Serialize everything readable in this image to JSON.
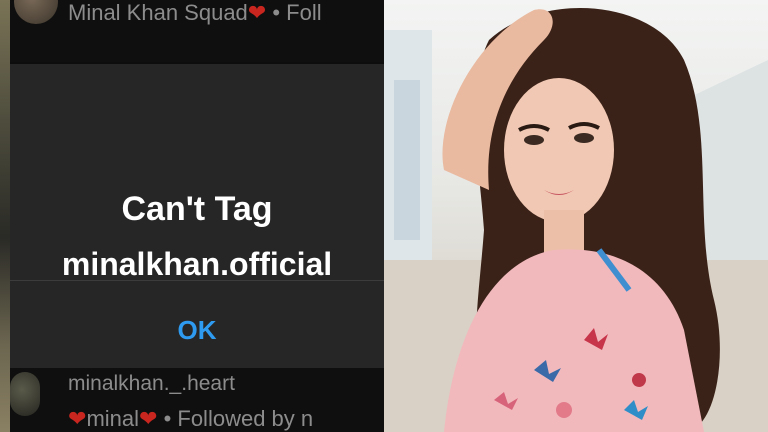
{
  "list": {
    "top_row": {
      "name": "Minal Khan Squad",
      "heart": "❤",
      "followed_prefix": " • Foll"
    },
    "bottom_row": {
      "handle": "minalkhan._.heart",
      "sub_heart1": "❤",
      "sub_name": "minal",
      "sub_heart2": "❤",
      "sub_followed": " • Followed by n"
    }
  },
  "dialog": {
    "title": "Can't Tag",
    "username": "minalkhan.official",
    "ok_label": "OK"
  },
  "colors": {
    "dialog_bg": "#262626",
    "accent_blue": "#2f9bf0",
    "heart_red": "#c8261f"
  },
  "photo": {
    "subject": "woman-portrait"
  }
}
